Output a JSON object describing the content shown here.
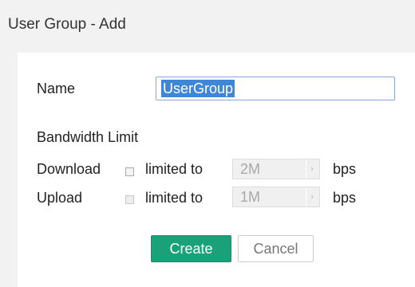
{
  "dialog": {
    "title": "User Group - Add"
  },
  "form": {
    "name_label": "Name",
    "name_value": "UserGroup",
    "bandwidth_heading": "Bandwidth Limit",
    "download": {
      "label": "Download",
      "checked": false,
      "limited_to_label": "limited to",
      "value": "2M",
      "unit": "bps"
    },
    "upload": {
      "label": "Upload",
      "checked": false,
      "limited_to_label": "limited to",
      "value": "1M",
      "unit": "bps"
    }
  },
  "actions": {
    "create_label": "Create",
    "cancel_label": "Cancel"
  },
  "colors": {
    "accent": "#1aa17a",
    "selection": "#3f87d6",
    "background": "#f2f2f2"
  }
}
